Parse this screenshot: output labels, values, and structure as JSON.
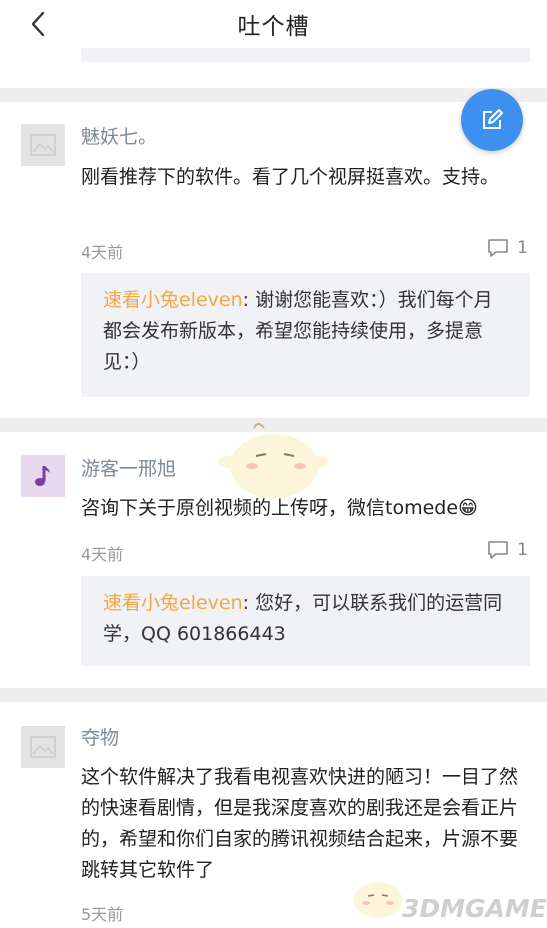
{
  "header": {
    "title": "吐个槽"
  },
  "comments": [
    {
      "username": "魅妖七。",
      "content": "刚看推荐下的软件。看了几个视屏挺喜欢。支持。",
      "time": "4天前",
      "reply_count": "1",
      "reply": {
        "author": "速看小兔eleven",
        "text": ": 谢谢您能喜欢：）我们每个月都会发布新版本，希望您能持续使用，多提意见：）"
      }
    },
    {
      "username": "游客一邢旭",
      "content": "咨询下关于原创视频的上传呀，微信tomede",
      "emoji": "😁",
      "time": "4天前",
      "reply_count": "1",
      "reply": {
        "author": "速看小兔eleven",
        "text": ": 您好，可以联系我们的运营同学，QQ 601866443"
      }
    },
    {
      "username": "夺物",
      "content": "这个软件解决了我看电视喜欢快进的陋习！一目了然的快速看剧情，但是我深度喜欢的剧我还是会看正片的，希望和你们自家的腾讯视频结合起来，片源不要跳转其它软件了",
      "time": "5天前"
    }
  ],
  "watermark": {
    "text": "3DMGAME"
  },
  "colors": {
    "accent": "#3d8ff0",
    "reply_author": "#f4a546",
    "separator": "#eeeeee"
  },
  "icons": {
    "back": "chevron-left-icon",
    "compose": "edit-icon",
    "reply": "comment-icon",
    "music": "music-note-icon"
  }
}
